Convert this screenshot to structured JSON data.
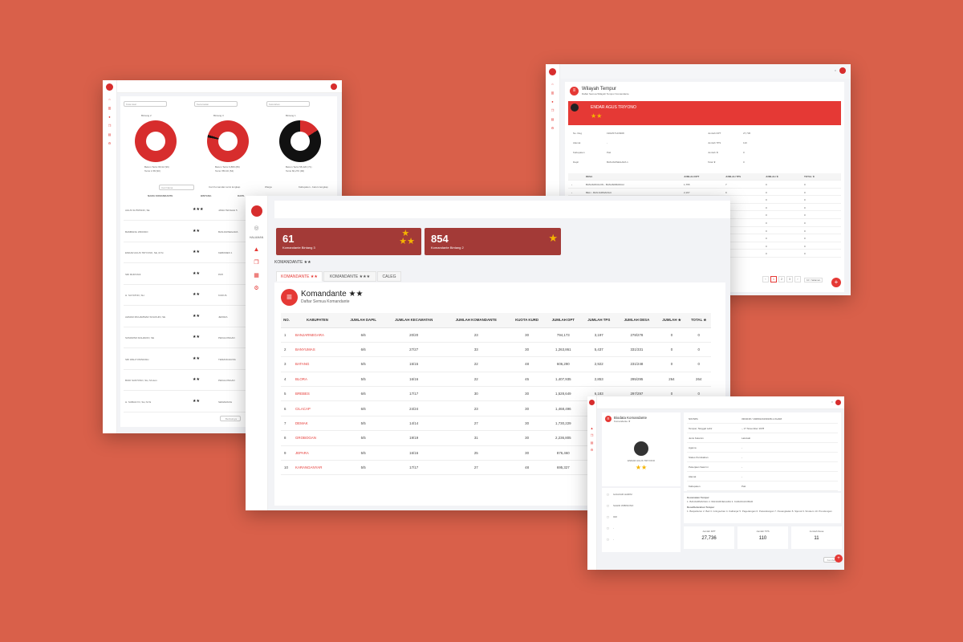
{
  "s1": {
    "filters": [
      "Kota Asal",
      "Kecamatan",
      "Kelurahan"
    ],
    "chart_titles": [
      "Bintang 2",
      "Bintang 3",
      "Bintang 1"
    ],
    "legend": [
      [
        "Belum Terisi 96,92 (96)",
        "Terisi 1.58 (90)"
      ],
      [
        "Belum Terisi 6,880 (89)",
        "Terisi 780.00 (54)"
      ],
      [
        "Belum Terisi 58,420 (71)",
        "Terisi 60,270 (90)"
      ]
    ],
    "search_placeholder": "Cari Nama",
    "checkboxes": [
      "Cari Komandan terisi lengkap",
      "Warga",
      "Kabupaten - belum lengkap"
    ],
    "columns": [
      "NAMA KOMANDANTE",
      "BINTANG",
      "DAPIL",
      "PERSENTASE TERISI"
    ],
    "rows": [
      [
        "AGUS SUTRISNO, SE",
        "★★★",
        "JAWA TENGAH 5"
      ],
      [
        "BAMBANG WIDODO",
        "★★",
        "BANJARNEGARA"
      ],
      [
        "ENDAR AGUS TRIYONO, SE, M.Si",
        "★★",
        "KEBUMEN 1"
      ],
      [
        "SRI MURYANI",
        "★★",
        "PATI"
      ],
      [
        "H. SUYATNO, SH",
        "★★",
        "KUDUS"
      ],
      [
        "AHMAD MUHAMMAD SOLIKHIN, SE",
        "★★",
        "JEPARA"
      ],
      [
        "SUMARNO RAHARJO, SE",
        "★★",
        "PEKALONGAN"
      ],
      [
        "SRI WAHYUNINGSIH",
        "★★",
        "TEMANGGUNG"
      ],
      [
        "BUDI SANTOSO, SH, M.Hum",
        "★★",
        "PEKALONGAN"
      ],
      [
        "H. SUBAGYO, SH, M.Si",
        "★★",
        "SEMARANG"
      ]
    ],
    "next_label": "Berikutnya"
  },
  "s2": {
    "title": "Wilayah Tempur",
    "subtitle": "Daftar Semua Wilayah Tempur Komandante",
    "name": "ENDAR AGUS TRIYONO",
    "stars": "★★",
    "info_left": [
      [
        "No. Reg",
        "1902/0714/0908"
      ],
      [
        "Alamat",
        "-"
      ],
      [
        "Kabupaten",
        "Pati"
      ],
      [
        "Dapil",
        "BANJARNEGARA 1"
      ]
    ],
    "info_right": [
      [
        "Jumlah DPT",
        "27,736"
      ],
      [
        "Jumlah TPS",
        "110"
      ],
      [
        "Jumlah ★",
        "0"
      ],
      [
        "Total ★",
        "0"
      ]
    ],
    "columns": [
      "DESA",
      "JUMLAH DPT",
      "JUMLAH TPS",
      "JUMLAH ★",
      "TOTAL ★"
    ],
    "rows": [
      [
        "BANJARKULON - BANJARMANGU",
        "1,755",
        "7",
        "0",
        "0"
      ],
      [
        "BELI - BANJARMANGU",
        "2,167",
        "9",
        "0",
        "0"
      ],
      [
        "GRINGSEHAN - BANJARMANGU",
        "2,099",
        "9",
        "0",
        "0"
      ],
      [
        "KALILUNJAR - BANJARMANGU",
        "994",
        "4",
        "0",
        "0"
      ],
      [
        "PAGEDANGAN - BANJARMANGU",
        "3,287",
        "15",
        "0",
        "0"
      ],
      [
        "PEKANDANGAN - BANJARMANGU",
        "1,683",
        "7",
        "0",
        "0"
      ],
      [
        "PESANGKALAN - BANJARMANGU",
        "1,728",
        "7",
        "0",
        "0"
      ],
      [
        "SIJERUK - BANJARMANGU",
        "3,303",
        "15",
        "0",
        "0"
      ],
      [
        "SIRUKEM - BANJARMANGU",
        "3,638",
        "15",
        "0",
        "0"
      ],
      [
        "PRENDENGAN - BANJARMANGU",
        "5,044",
        "22",
        "0",
        "0"
      ]
    ],
    "pager": [
      "‹",
      "1",
      "2",
      "3",
      "›"
    ],
    "per_page": "10 / halaman"
  },
  "s3": {
    "side_label": "HALAMAN",
    "stats": [
      {
        "num": "61",
        "label": "Komandante Bintang 3"
      },
      {
        "num": "854",
        "label": "Komandante Bintang 2"
      }
    ],
    "breadcrumb": "KOMANDANTE ★★",
    "tabs": [
      "KOMANDANTE ★★",
      "KOMANDANTE ★★★",
      "CALEG"
    ],
    "title": "Komandante ★★",
    "subtitle": "Daftar Semua Komandante",
    "columns": [
      "NO.",
      "KABUPATEN",
      "JUMLAH DAPIL",
      "JUMLAH KECAMATAN",
      "JUMLAH KOMANDANTE",
      "KUOTA KURD",
      "JUMLAH DPT",
      "JUMLAH TPS",
      "JUMLAH DESA",
      "JUMLAH ★",
      "TOTAL ★"
    ],
    "rows": [
      [
        "1",
        "BANJARNEGARA",
        "6/6",
        "20/20",
        "23",
        "30",
        "794,173",
        "3,197",
        "278/278",
        "0",
        "0"
      ],
      [
        "2",
        "BANYUMAS",
        "6/6",
        "27/27",
        "33",
        "30",
        "1,263,861",
        "5,437",
        "331/331",
        "0",
        "0"
      ],
      [
        "3",
        "BATANG",
        "5/5",
        "15/15",
        "22",
        "48",
        "606,290",
        "2,922",
        "231/248",
        "0",
        "0"
      ],
      [
        "4",
        "BLORA",
        "5/5",
        "16/16",
        "22",
        "45",
        "1,407,935",
        "2,853",
        "295/295",
        "264",
        "264"
      ],
      [
        "5",
        "BREBES",
        "6/6",
        "17/17",
        "30",
        "30",
        "1,528,649",
        "6,183",
        "297/297",
        "0",
        "0"
      ],
      [
        "6",
        "CILACAP",
        "6/6",
        "24/24",
        "23",
        "30",
        "1,468,496",
        "6,190",
        "284/284",
        "0",
        "0"
      ],
      [
        "7",
        "DEMAK",
        "5/5",
        "14/14",
        "27",
        "30",
        "1,730,229",
        "5,197",
        "249/249",
        "0",
        "0"
      ],
      [
        "8",
        "GROBOGAN",
        "5/5",
        "19/19",
        "31",
        "30",
        "2,236,805",
        "4,822",
        "280/280",
        "0",
        "0"
      ],
      [
        "9",
        "JEPARA",
        "5/5",
        "16/16",
        "25",
        "30",
        "876,460",
        "3,916",
        "195/195",
        "0",
        "0"
      ],
      [
        "10",
        "KARANGANYAR",
        "5/5",
        "17/17",
        "27",
        "48",
        "695,327",
        "2,914",
        "177/177",
        "0",
        "0"
      ]
    ]
  },
  "s4": {
    "title": "Biodata Komandante",
    "subtitle": "Komandante ★",
    "name": "ENDAR AGUS TRIYONO",
    "stars": "★★",
    "contacts": [
      "GAGOAR HARIM",
      "SAHID WIBISONO",
      "020",
      "-",
      "-"
    ],
    "info": [
      [
        "NIK/NPA",
        "3304018 / 19280124190108-1-KHARI"
      ],
      [
        "Tempat, Tanggal Lahir",
        "-, 17 November 1978"
      ],
      [
        "Jenis Kelamin",
        "Laki-laki"
      ],
      [
        "Agama",
        "-"
      ],
      [
        "Status Pernikahan",
        "-"
      ],
      [
        "Pekerjaan Saat Ini",
        "-"
      ],
      [
        "Alamat",
        "-"
      ],
      [
        "Kabupaten",
        "Pati"
      ]
    ],
    "area_title": "Kecamatan Tempur",
    "area_text": "1. BANJARMANGU  2. BANJARNEGARA  3. KARANGKOBAR",
    "desa_title": "Desa/Kelurahan Tempur",
    "desa_text": "1. Banjarkulon  2. Beli  3. Gringsehan  4. Kalilunjar  5. Pagedangan  6. Pekandangan  7. Pesangkalan  8. Sijeruk  9. Sirukem  10. Prendengan",
    "stats": [
      [
        "Jumlah DPT",
        "27,736"
      ],
      [
        "Jumlah TPS",
        "110"
      ],
      [
        "Jumlah Desa",
        "11"
      ]
    ],
    "back_label": "Kembali"
  },
  "colors": {
    "background": "#d9604a",
    "accent": "#e53935",
    "banner": "#a33a37",
    "star": "#f5b400"
  }
}
